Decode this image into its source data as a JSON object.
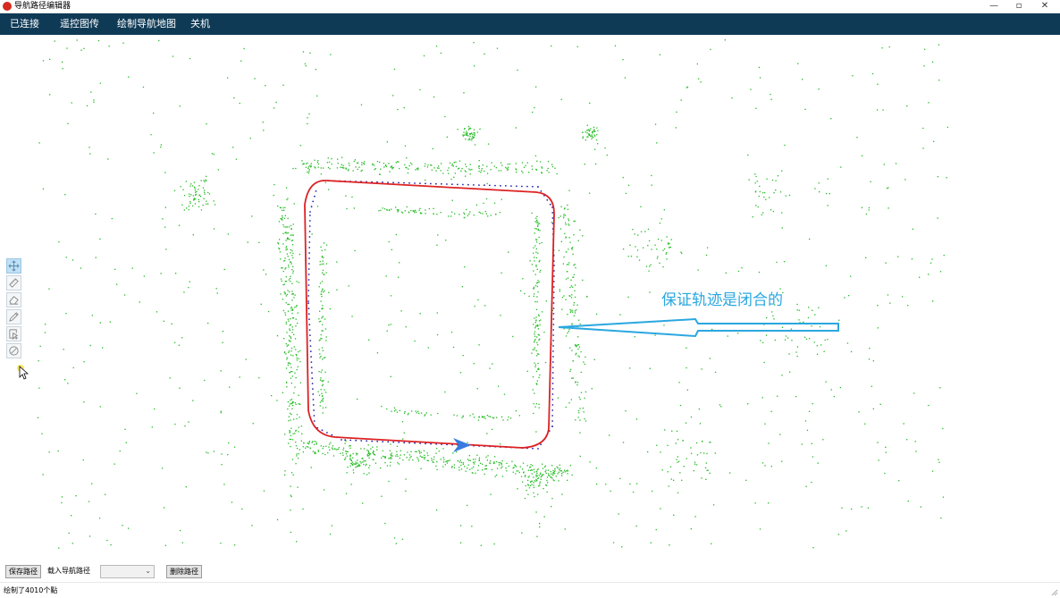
{
  "window": {
    "title": "导航路径编辑器",
    "controls": {
      "minimize": "—",
      "maximize": "▫",
      "close": "✕"
    }
  },
  "menu": {
    "items": [
      {
        "label": "已连接"
      },
      {
        "label": "遥控图传"
      },
      {
        "label": "绘制导航地图"
      },
      {
        "label": "关机"
      }
    ]
  },
  "toolbar": {
    "tools": [
      {
        "icon": "move-icon",
        "active": true
      },
      {
        "icon": "ruler-icon",
        "active": false
      },
      {
        "icon": "eraser-icon",
        "active": false
      },
      {
        "icon": "pen-icon",
        "active": false
      },
      {
        "icon": "select-cursor-icon",
        "active": false
      },
      {
        "icon": "target-icon",
        "active": false
      }
    ]
  },
  "canvas": {
    "annotation": "保证轨迹是闭合的",
    "colors": {
      "points": "#22bb22",
      "path": "#dd2222",
      "recorded_path": "#2222aa",
      "direction_arrow": "#3a7be0",
      "callout": "#2aa7e0"
    }
  },
  "bottom": {
    "save_button": "保存路径",
    "load_label": "载入导航路径",
    "load_select_value": "",
    "delete_button": "删除路径"
  },
  "status": {
    "text": "绘制了4010个點"
  }
}
